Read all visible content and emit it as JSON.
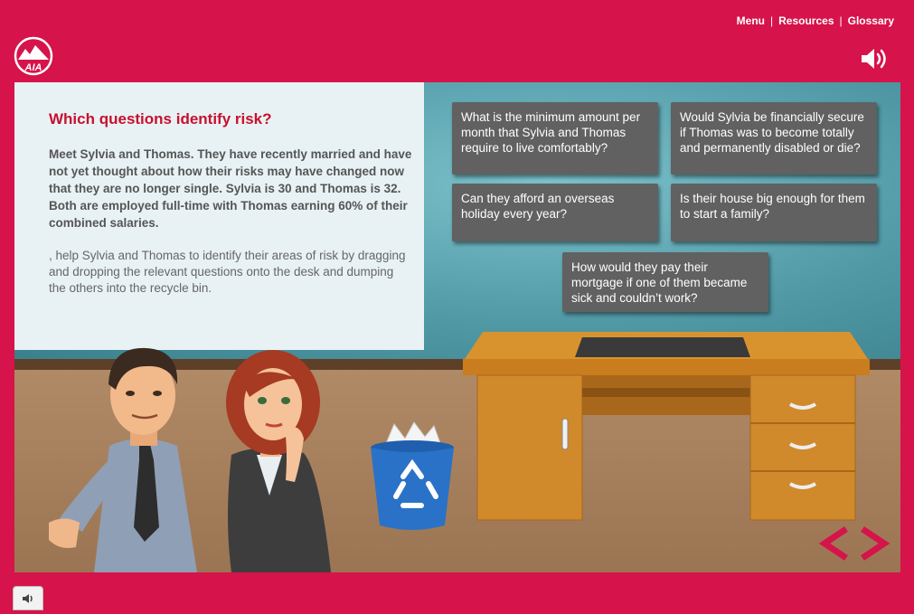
{
  "header": {
    "logo_text": "AIA",
    "links": [
      "Menu",
      "Resources",
      "Glossary"
    ],
    "separator": "|",
    "audio_icon": "speaker-icon"
  },
  "panel": {
    "title": "Which questions identify risk?",
    "intro": "Meet Sylvia and Thomas. They have recently married and have not yet thought about how their risks may have changed now that they are no longer single. Sylvia is 30 and Thomas is 32. Both are employed full-time with Thomas earning 60% of their combined salaries.",
    "instructions": ", help Sylvia and Thomas to identify their areas of risk by dragging and dropping the relevant questions onto the desk and dumping the others into the recycle bin."
  },
  "questions": [
    "What is the minimum amount per month that Sylvia and Thomas require to live comfortably?",
    "Would Sylvia be financially secure if Thomas was to become totally and permanently disabled or die?",
    "Can they afford an overseas holiday every year?",
    "Is their house big enough for them to start a family?",
    "How would they pay their mortgage if one of them became sick and couldn’t work?"
  ],
  "scene": {
    "characters": [
      "Thomas",
      "Sylvia"
    ],
    "desk_icon": "desk-icon",
    "bin_icon": "recycle-bin-icon"
  },
  "navigation": {
    "prev_icon": "chevron-left-icon",
    "next_icon": "chevron-right-icon"
  },
  "footer": {
    "mute_icon": "speaker-small-icon"
  },
  "colors": {
    "brand": "#d6134a",
    "title": "#c8102e",
    "card": "#616161",
    "panel": "#e8f2f4"
  }
}
